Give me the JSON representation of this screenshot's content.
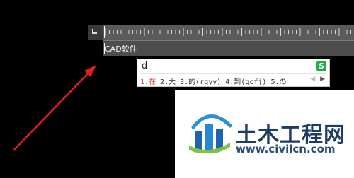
{
  "command_line": {
    "input_value": "CAD软件"
  },
  "ime": {
    "composition": "d",
    "candidates": [
      {
        "label": "1.在",
        "active": true
      },
      {
        "label": "2.大",
        "active": false
      },
      {
        "label": "3.的(rqyy)",
        "active": false
      },
      {
        "label": "4.到(gcfj)",
        "active": false
      },
      {
        "label": "5.の",
        "active": false
      }
    ],
    "prev_glyph": "◀",
    "next_glyph": "▶",
    "logo_glyph": "S",
    "logo_color": "#17b34a"
  },
  "watermark": {
    "title": "土木工程网",
    "url": "www.civilcn.com"
  },
  "colors": {
    "annotation_arrow": "#e02020",
    "active_candidate": "#e03b3b"
  }
}
